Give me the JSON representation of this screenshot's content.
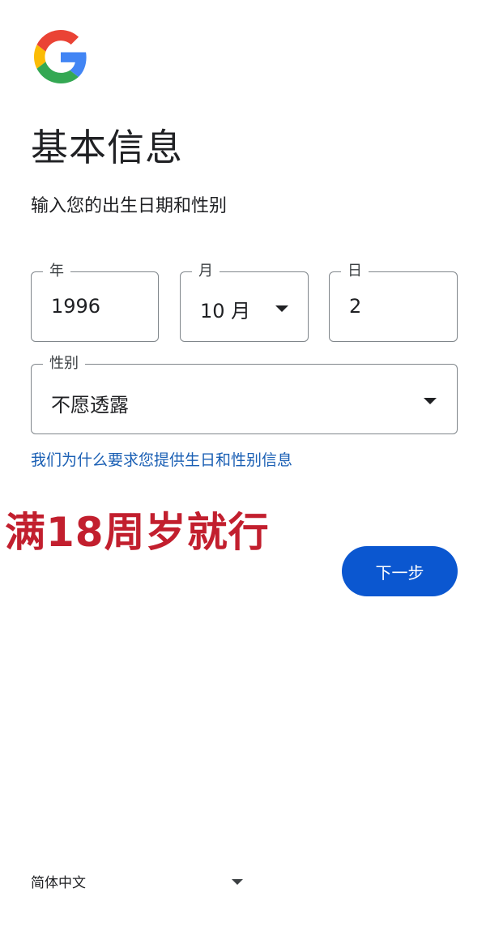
{
  "brand": {
    "logo_icon": "google-g-icon",
    "colors": {
      "blue": "#4285F4",
      "red": "#EA4335",
      "yellow": "#FBBC05",
      "green": "#34A853"
    }
  },
  "header": {
    "title": "基本信息",
    "subtitle": "输入您的出生日期和性别"
  },
  "form": {
    "year": {
      "label": "年",
      "value": "1996"
    },
    "month": {
      "label": "月",
      "value": "10 月"
    },
    "day": {
      "label": "日",
      "value": "2"
    },
    "gender": {
      "label": "性别",
      "value": "不愿透露"
    }
  },
  "why_link": "我们为什么要求您提供生日和性别信息",
  "overlay_text": "满18周岁就行",
  "next_button": "下一步",
  "footer": {
    "language": "简体中文"
  },
  "accent_color": "#0b57d0",
  "link_color": "#1a5fb4",
  "overlay_color": "#c21f2e"
}
